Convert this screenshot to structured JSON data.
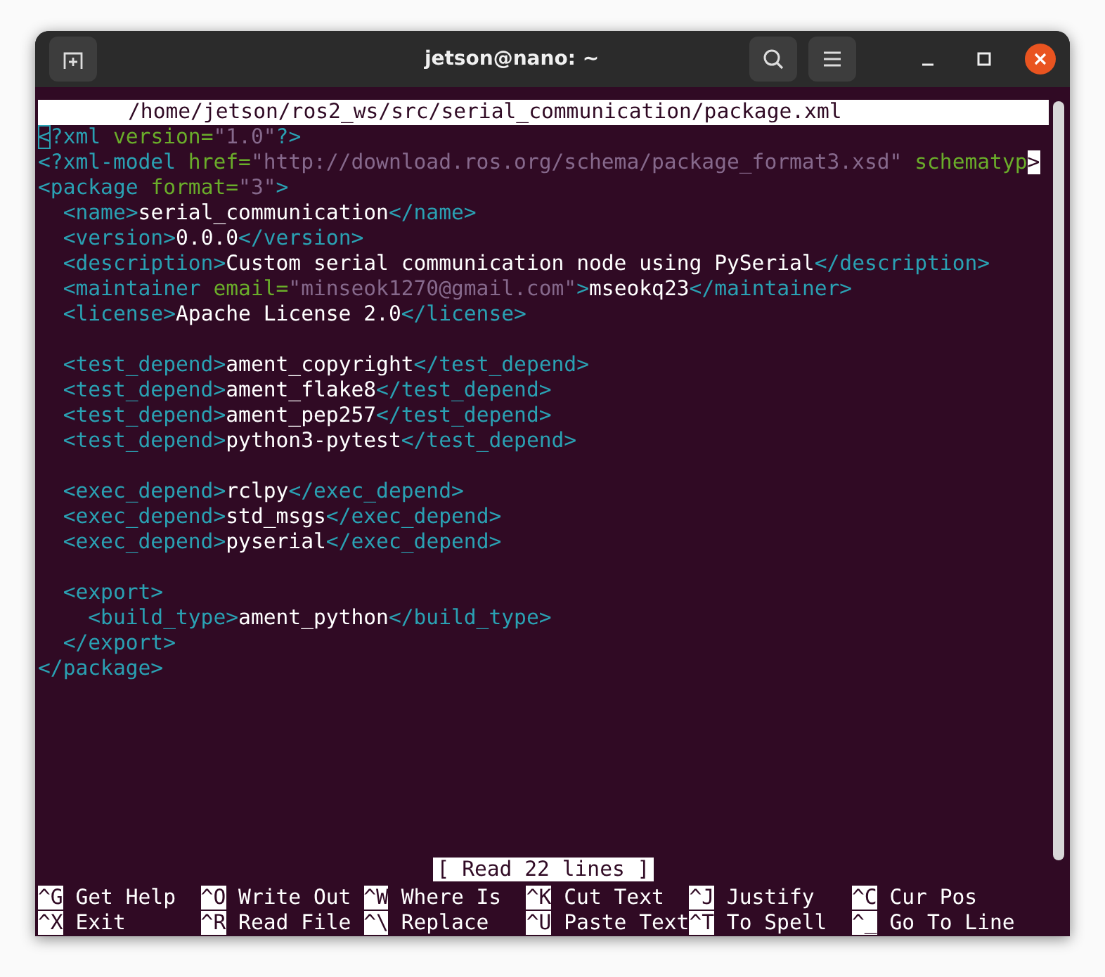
{
  "window": {
    "title": "jetson@nano: ~"
  },
  "editor": {
    "path": "/home/jetson/ros2_ws/src/serial_communication/package.xml",
    "lines": [
      {
        "kind": "code",
        "segments": [
          {
            "kind": "cursor",
            "text": "<"
          },
          {
            "kind": "tag",
            "text": "?xml "
          },
          {
            "kind": "attr",
            "text": "version="
          },
          {
            "kind": "string",
            "text": "\"1.0\""
          },
          {
            "kind": "tag",
            "text": "?>"
          }
        ]
      },
      {
        "kind": "code",
        "segments": [
          {
            "kind": "tag",
            "text": "<?xml-model "
          },
          {
            "kind": "attr",
            "text": "href="
          },
          {
            "kind": "string",
            "text": "\"http://download.ros.org/schema/package_format3.xsd\" "
          },
          {
            "kind": "attr",
            "text": "schematyp"
          },
          {
            "kind": "overflow",
            "text": ">"
          }
        ]
      },
      {
        "kind": "code",
        "segments": [
          {
            "kind": "tag",
            "text": "<package "
          },
          {
            "kind": "attr",
            "text": "format="
          },
          {
            "kind": "string",
            "text": "\"3\""
          },
          {
            "kind": "tag",
            "text": ">"
          }
        ]
      },
      {
        "kind": "code",
        "segments": [
          {
            "kind": "tag",
            "text": "  <name>"
          },
          {
            "kind": "text",
            "text": "serial_communication"
          },
          {
            "kind": "tag",
            "text": "</name>"
          }
        ]
      },
      {
        "kind": "code",
        "segments": [
          {
            "kind": "tag",
            "text": "  <version>"
          },
          {
            "kind": "text",
            "text": "0.0.0"
          },
          {
            "kind": "tag",
            "text": "</version>"
          }
        ]
      },
      {
        "kind": "code",
        "segments": [
          {
            "kind": "tag",
            "text": "  <description>"
          },
          {
            "kind": "text",
            "text": "Custom serial communication node using PySerial"
          },
          {
            "kind": "tag",
            "text": "</description>"
          }
        ]
      },
      {
        "kind": "code",
        "segments": [
          {
            "kind": "tag",
            "text": "  <maintainer "
          },
          {
            "kind": "attr",
            "text": "email="
          },
          {
            "kind": "string",
            "text": "\"minseok1270@gmail.com\""
          },
          {
            "kind": "tag",
            "text": ">"
          },
          {
            "kind": "text",
            "text": "mseokq23"
          },
          {
            "kind": "tag",
            "text": "</maintainer>"
          }
        ]
      },
      {
        "kind": "code",
        "segments": [
          {
            "kind": "tag",
            "text": "  <license>"
          },
          {
            "kind": "text",
            "text": "Apache License 2.0"
          },
          {
            "kind": "tag",
            "text": "</license>"
          }
        ]
      },
      {
        "kind": "blank"
      },
      {
        "kind": "code",
        "segments": [
          {
            "kind": "tag",
            "text": "  <test_depend>"
          },
          {
            "kind": "text",
            "text": "ament_copyright"
          },
          {
            "kind": "tag",
            "text": "</test_depend>"
          }
        ]
      },
      {
        "kind": "code",
        "segments": [
          {
            "kind": "tag",
            "text": "  <test_depend>"
          },
          {
            "kind": "text",
            "text": "ament_flake8"
          },
          {
            "kind": "tag",
            "text": "</test_depend>"
          }
        ]
      },
      {
        "kind": "code",
        "segments": [
          {
            "kind": "tag",
            "text": "  <test_depend>"
          },
          {
            "kind": "text",
            "text": "ament_pep257"
          },
          {
            "kind": "tag",
            "text": "</test_depend>"
          }
        ]
      },
      {
        "kind": "code",
        "segments": [
          {
            "kind": "tag",
            "text": "  <test_depend>"
          },
          {
            "kind": "text",
            "text": "python3-pytest"
          },
          {
            "kind": "tag",
            "text": "</test_depend>"
          }
        ]
      },
      {
        "kind": "blank"
      },
      {
        "kind": "code",
        "segments": [
          {
            "kind": "tag",
            "text": "  <exec_depend>"
          },
          {
            "kind": "text",
            "text": "rclpy"
          },
          {
            "kind": "tag",
            "text": "</exec_depend>"
          }
        ]
      },
      {
        "kind": "code",
        "segments": [
          {
            "kind": "tag",
            "text": "  <exec_depend>"
          },
          {
            "kind": "text",
            "text": "std_msgs"
          },
          {
            "kind": "tag",
            "text": "</exec_depend>"
          }
        ]
      },
      {
        "kind": "code",
        "segments": [
          {
            "kind": "tag",
            "text": "  <exec_depend>"
          },
          {
            "kind": "text",
            "text": "pyserial"
          },
          {
            "kind": "tag",
            "text": "</exec_depend>"
          }
        ]
      },
      {
        "kind": "blank"
      },
      {
        "kind": "code",
        "segments": [
          {
            "kind": "tag",
            "text": "  <export>"
          }
        ]
      },
      {
        "kind": "code",
        "segments": [
          {
            "kind": "tag",
            "text": "    <build_type>"
          },
          {
            "kind": "text",
            "text": "ament_python"
          },
          {
            "kind": "tag",
            "text": "</build_type>"
          }
        ]
      },
      {
        "kind": "code",
        "segments": [
          {
            "kind": "tag",
            "text": "  </export>"
          }
        ]
      },
      {
        "kind": "code",
        "segments": [
          {
            "kind": "tag",
            "text": "</package>"
          }
        ]
      }
    ],
    "status": "[ Read 22 lines ]",
    "shortcuts": [
      [
        {
          "key": "^G",
          "label": "Get Help"
        },
        {
          "key": "^O",
          "label": "Write Out"
        },
        {
          "key": "^W",
          "label": "Where Is"
        },
        {
          "key": "^K",
          "label": "Cut Text"
        },
        {
          "key": "^J",
          "label": "Justify"
        },
        {
          "key": "^C",
          "label": "Cur Pos"
        }
      ],
      [
        {
          "key": "^X",
          "label": "Exit"
        },
        {
          "key": "^R",
          "label": "Read File"
        },
        {
          "key": "^\\",
          "label": "Replace"
        },
        {
          "key": "^U",
          "label": "Paste Text"
        },
        {
          "key": "^T",
          "label": "To Spell"
        },
        {
          "key": "^_",
          "label": "Go To Line"
        }
      ]
    ]
  }
}
